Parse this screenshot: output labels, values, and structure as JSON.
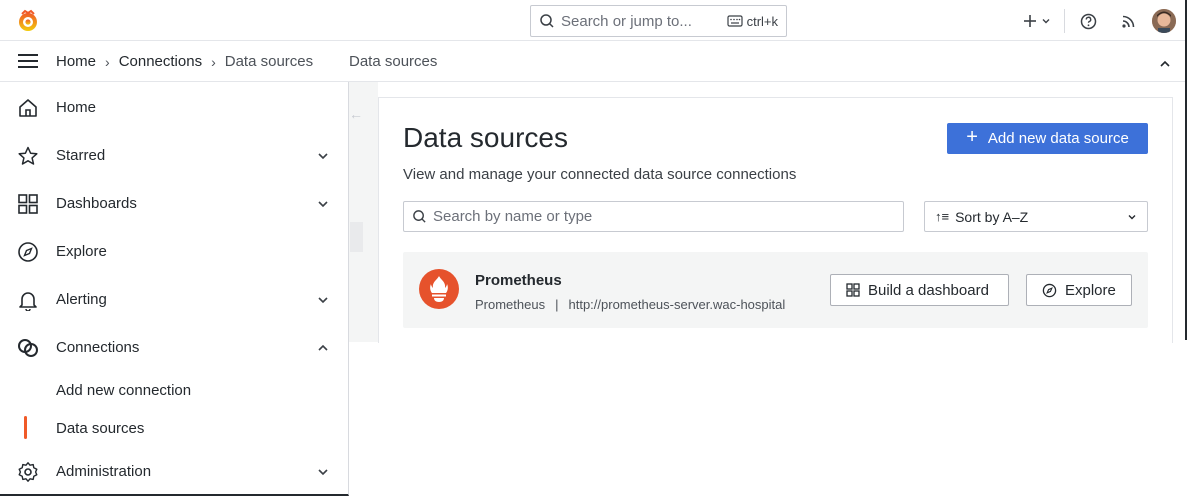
{
  "topbar": {
    "search_placeholder": "Search or jump to...",
    "search_shortcut": "ctrl+k",
    "icons": [
      "grafana-logo-icon",
      "search-icon",
      "keyboard-icon",
      "plus-icon",
      "help-icon",
      "news-rss-icon",
      "avatar"
    ]
  },
  "breadcrumb": {
    "items": [
      "Home",
      "Connections",
      "Data sources"
    ],
    "extra": "Data sources"
  },
  "sidebar": {
    "items": [
      {
        "label": "Home",
        "icon": "home-icon"
      },
      {
        "label": "Starred",
        "icon": "star-icon",
        "chevron": "down"
      },
      {
        "label": "Dashboards",
        "icon": "dashboards-grid-icon",
        "chevron": "down"
      },
      {
        "label": "Explore",
        "icon": "compass-icon"
      },
      {
        "label": "Alerting",
        "icon": "bell-icon",
        "chevron": "down"
      },
      {
        "label": "Connections",
        "icon": "connections-icon",
        "chevron": "up"
      },
      {
        "label": "Administration",
        "icon": "gear-icon",
        "chevron": "down"
      }
    ],
    "subitems": [
      "Add new connection",
      "Data sources"
    ],
    "active": "Data sources"
  },
  "main": {
    "title": "Data sources",
    "subtitle": "View and manage your connected data source connections",
    "add_button": "Add new data source",
    "search_placeholder": "Search by name or type",
    "sort_label": "Sort by A–Z",
    "datasources": [
      {
        "name": "Prometheus",
        "type": "Prometheus",
        "url": "http://prometheus-server.wac-hospital",
        "actions": [
          "Build a dashboard",
          "Explore"
        ]
      }
    ]
  },
  "colors": {
    "accent": "#3d71d9",
    "active_bar": "#f05a28",
    "prometheus": "#e6522c"
  }
}
